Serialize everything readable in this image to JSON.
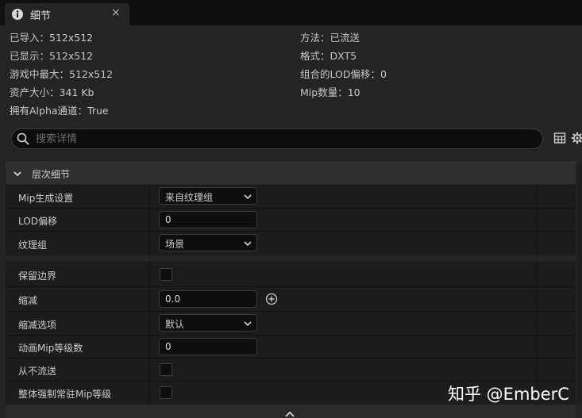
{
  "tab": {
    "title": "细节",
    "close_glyph": "×",
    "icon": "info-icon"
  },
  "info": {
    "left": [
      "已导入：512x512",
      "已显示：512x512",
      "游戏中最大：512x512",
      "资产大小：341 Kb",
      "拥有Alpha通道：True"
    ],
    "right": [
      "方法：已流送",
      "格式：DXT5",
      "组合的LOD偏移：0",
      "Mip数量：10"
    ]
  },
  "search": {
    "placeholder": "搜索详情",
    "value": ""
  },
  "section": {
    "title": "层次细节"
  },
  "rows_a": [
    {
      "label": "Mip生成设置",
      "control": "combo",
      "value": "来自纹理组"
    },
    {
      "label": "LOD偏移",
      "control": "field",
      "value": "0"
    },
    {
      "label": "纹理组",
      "control": "combo",
      "value": "场景"
    }
  ],
  "rows_b": [
    {
      "label": "保留边界",
      "control": "check",
      "checked": false
    },
    {
      "label": "缩减",
      "control": "field",
      "value": "0.0"
    },
    {
      "label": "缩减选项",
      "control": "combo",
      "value": "默认"
    },
    {
      "label": "动画Mip等级数",
      "control": "field",
      "value": "0"
    },
    {
      "label": "从不流送",
      "control": "check",
      "checked": false
    },
    {
      "label": "整体强制常驻Mip等级",
      "control": "check",
      "checked": false
    }
  ],
  "watermark": "知乎 @EmberC",
  "colors": {
    "background": "#242424",
    "input_bg": "#0e0e0e",
    "header_bg": "#2f2f2f"
  }
}
